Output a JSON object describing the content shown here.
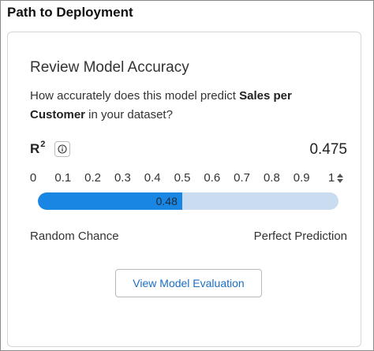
{
  "panel": {
    "title": "Path to Deployment"
  },
  "card": {
    "heading": "Review Model Accuracy",
    "question_prefix": "How accurately does this model predict ",
    "question_target": "Sales per Customer",
    "question_suffix": " in your dataset?"
  },
  "metric": {
    "label": "R",
    "superscript": "2",
    "info_icon": "info-circle-icon",
    "value": "0.475"
  },
  "scale": {
    "ticks": [
      "0",
      "0.1",
      "0.2",
      "0.3",
      "0.4",
      "0.5",
      "0.6",
      "0.7",
      "0.8",
      "0.9",
      "1"
    ],
    "spinner_icon": "up-down-spinner-icon",
    "bar_value": 0.48,
    "bar_label": "0.48",
    "min_label": "Random Chance",
    "max_label": "Perfect Prediction"
  },
  "actions": {
    "view_evaluation_label": "View Model Evaluation"
  },
  "colors": {
    "fill": "#1a86e3",
    "track": "#c9dcf0",
    "link": "#1a6fc4"
  }
}
